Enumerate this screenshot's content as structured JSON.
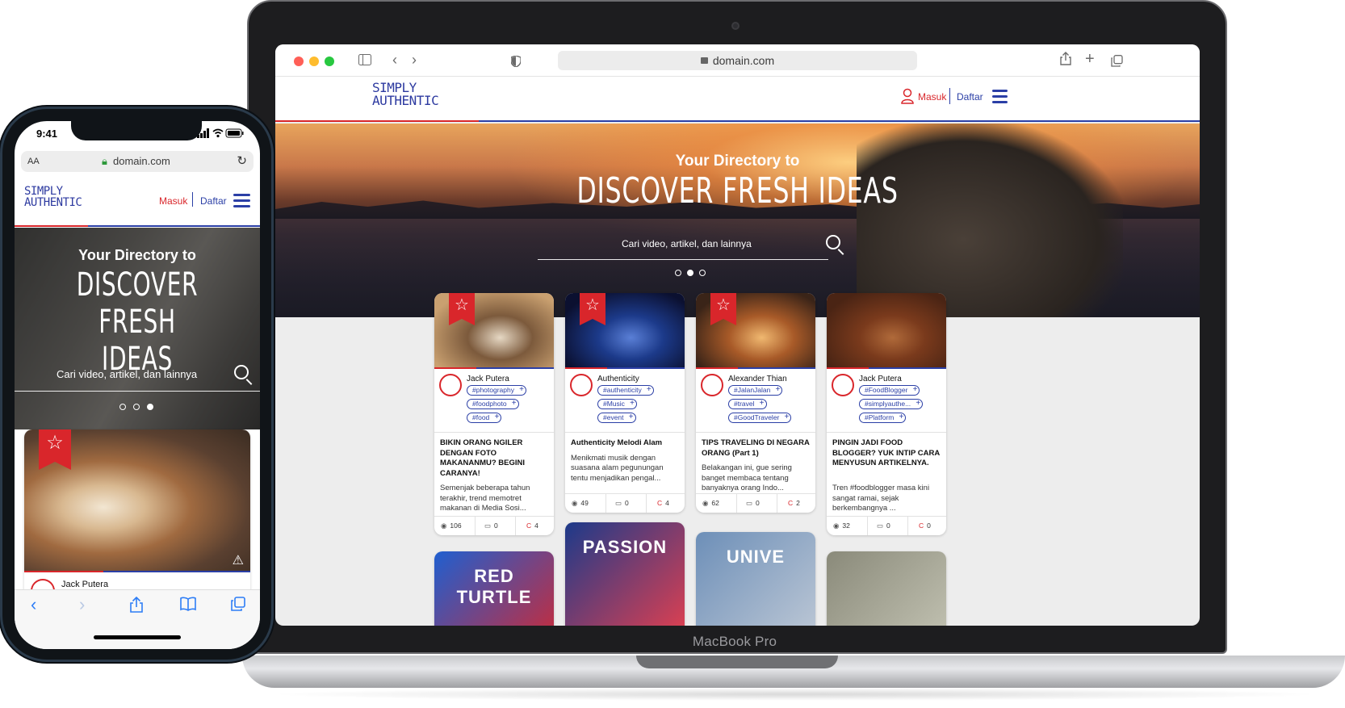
{
  "brand": {
    "line1": "SIMPLY",
    "line2": "AUTHENTIC"
  },
  "browser": {
    "url": "domain.com"
  },
  "nav": {
    "login": "Masuk",
    "register": "Daftar"
  },
  "hero": {
    "subtitle": "Your Directory to",
    "title": "DISCOVER FRESH IDEAS",
    "title_line1": "DISCOVER FRESH",
    "title_line2": "IDEAS",
    "search_placeholder": "Cari video, artikel, dan lainnya"
  },
  "laptop": {
    "model": "MacBook Pro"
  },
  "phone": {
    "time": "9:41",
    "text_size": "AA"
  },
  "cards": [
    {
      "author": "Jack Putera",
      "tags": [
        "#photography",
        "#foodphoto",
        "#food"
      ],
      "title": "BIKIN ORANG NGILER DENGAN FOTO MAKANANMU? BEGINI CARANYA!",
      "excerpt": "Semenjak beberapa tahun terakhir, trend memotret makanan di Media Sosi...",
      "views": "106",
      "comments": "0",
      "shares": "4",
      "img_colors": [
        "#c9a070",
        "#7c5a3c",
        "#e6d8c4"
      ],
      "bookmarked": true
    },
    {
      "author": "Authenticity",
      "tags": [
        "#authenticity",
        "#Music",
        "#event"
      ],
      "title": "Authenticity Melodi Alam",
      "excerpt": "Menikmati musik dengan suasana alam pegunungan tentu menjadikan pengal...",
      "views": "49",
      "comments": "0",
      "shares": "4",
      "img_colors": [
        "#0b1030",
        "#1c3a8a",
        "#5a7fd6"
      ],
      "bookmarked": true
    },
    {
      "author": "Alexander Thian",
      "tags": [
        "#JalanJalan",
        "#travel",
        "#GoodTraveler"
      ],
      "title": "TIPS TRAVELING DI NEGARA ORANG (Part 1)",
      "excerpt": "Belakangan ini, gue sering banget membaca tentang banyaknya orang Indo...",
      "views": "62",
      "comments": "0",
      "shares": "2",
      "img_colors": [
        "#3a2418",
        "#a85a28",
        "#f0b870"
      ],
      "bookmarked": true
    },
    {
      "author": "Jack Putera",
      "tags": [
        "#FoodBlogger",
        "#simplyauthe...",
        "#Platform"
      ],
      "title": "PINGIN JADI FOOD BLOGGER? YUK INTIP CARA MENYUSUN ARTIKELNYA.",
      "excerpt": "Tren #foodblogger masa kini sangat ramai, sejak berkembangnya ...",
      "views": "32",
      "comments": "0",
      "shares": "0",
      "img_colors": [
        "#4a2414",
        "#7a3a1c",
        "#b06a3a"
      ],
      "bookmarked": false
    }
  ],
  "lower_cards": [
    {
      "image_text": "RED TURTLE",
      "img_colors": [
        "#1f5fd0",
        "#d9262b"
      ]
    },
    {
      "image_text": "PASSION",
      "img_colors": [
        "#1c3a8a",
        "#e04050"
      ]
    },
    {
      "image_text": "UNIVE",
      "img_colors": [
        "#6d8fb8",
        "#bfc9d6"
      ]
    },
    {
      "image_text": "",
      "img_colors": [
        "#8a8a7a",
        "#c8c8b8"
      ]
    }
  ],
  "mobile_card": {
    "author": "Jack Putera"
  },
  "colors": {
    "brand_red": "#d9262b",
    "brand_blue": "#2b3fa6",
    "ios_blue": "#2d7df6"
  },
  "icons": [
    "search-icon",
    "star-icon",
    "eye-icon",
    "comment-icon",
    "share-icon",
    "menu-icon",
    "user-icon",
    "lock-icon",
    "sidebar-icon",
    "back-icon",
    "forward-icon",
    "plus-icon",
    "tabs-icon",
    "reload-icon",
    "bookmarks-icon",
    "warning-icon"
  ]
}
